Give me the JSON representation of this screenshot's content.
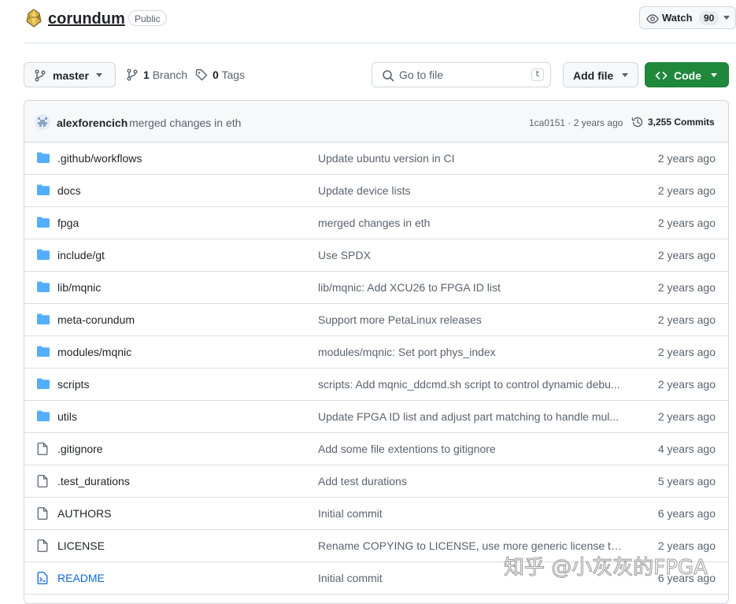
{
  "repo": {
    "name": "corundum",
    "visibility": "Public"
  },
  "watch": {
    "label": "Watch",
    "count": "90"
  },
  "toolbar": {
    "branch": "master",
    "branches_count": "1",
    "branches_label": "Branch",
    "tags_count": "0",
    "tags_label": "Tags",
    "search_placeholder": "Go to file",
    "search_shortcut": "t",
    "add_file_label": "Add file",
    "code_label": "Code"
  },
  "latest_commit": {
    "author": "alexforencich",
    "message": "merged changes in eth",
    "meta": "1ca0151 · 2 years ago",
    "commits": "3,255 Commits"
  },
  "files": [
    {
      "type": "folder",
      "name": ".github/workflows",
      "message": "Update ubuntu version in CI",
      "age": "2 years ago"
    },
    {
      "type": "folder",
      "name": "docs",
      "message": "Update device lists",
      "age": "2 years ago"
    },
    {
      "type": "folder",
      "name": "fpga",
      "message": "merged changes in eth",
      "age": "2 years ago"
    },
    {
      "type": "folder",
      "name": "include/gt",
      "message": "Use SPDX",
      "age": "2 years ago"
    },
    {
      "type": "folder",
      "name": "lib/mqnic",
      "message": "lib/mqnic: Add XCU26 to FPGA ID list",
      "age": "2 years ago"
    },
    {
      "type": "folder",
      "name": "meta-corundum",
      "message": "Support more PetaLinux releases",
      "age": "2 years ago"
    },
    {
      "type": "folder",
      "name": "modules/mqnic",
      "message": "modules/mqnic: Set port phys_index",
      "age": "2 years ago"
    },
    {
      "type": "folder",
      "name": "scripts",
      "message": "scripts: Add mqnic_ddcmd.sh script to control dynamic debu...",
      "age": "2 years ago"
    },
    {
      "type": "folder",
      "name": "utils",
      "message": "Update FPGA ID list and adjust part matching to handle mul...",
      "age": "2 years ago"
    },
    {
      "type": "file",
      "name": ".gitignore",
      "message": "Add some file extentions to gitignore",
      "age": "4 years ago"
    },
    {
      "type": "file",
      "name": ".test_durations",
      "message": "Add test durations",
      "age": "5 years ago"
    },
    {
      "type": "file",
      "name": "AUTHORS",
      "message": "Initial commit",
      "age": "6 years ago"
    },
    {
      "type": "file",
      "name": "LICENSE",
      "message": "Rename COPYING to LICENSE, use more generic license text",
      "age": "2 years ago"
    },
    {
      "type": "readme",
      "name": "README",
      "message": "Initial commit",
      "age": "6 years ago"
    }
  ],
  "watermark": "知乎 @小灰灰的FPGA",
  "colors": {
    "folder": "#54aeff",
    "link": "#0969da",
    "code_button": "#1f883d",
    "muted": "#59636e"
  }
}
